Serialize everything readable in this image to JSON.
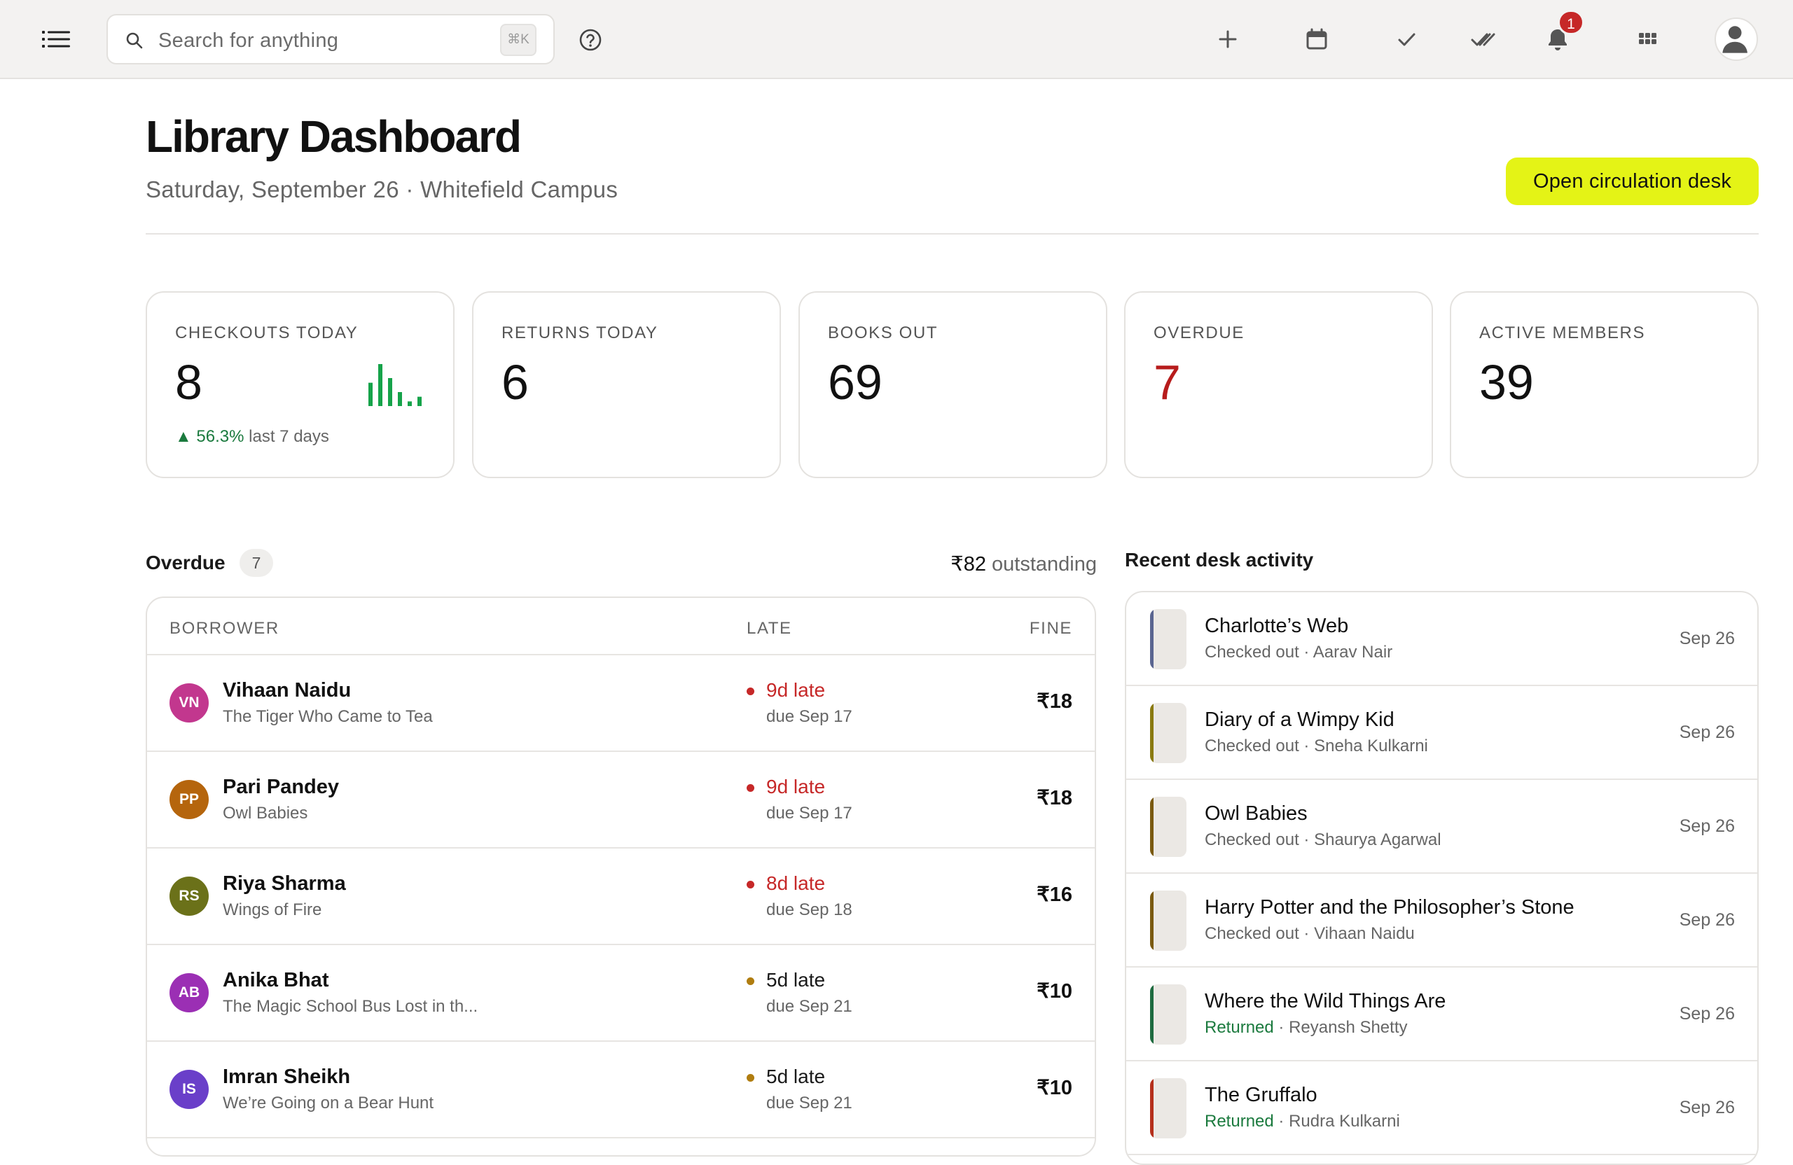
{
  "topbar": {
    "search_placeholder": "Search for anything",
    "search_shortcut": "⌘K",
    "notification_count": "1",
    "icons": [
      "menu-icon",
      "search-icon",
      "help-icon",
      "plus-icon",
      "calendar-icon",
      "check-icon",
      "double-check-icon",
      "bell-icon",
      "apps-grid-icon",
      "user-avatar"
    ]
  },
  "header": {
    "title": "Library Dashboard",
    "subtitle": "Saturday, September 26 · Whitefield Campus",
    "cta_label": "Open circulation desk",
    "cta_color": "#e4f316"
  },
  "stats": [
    {
      "label": "CHECKOUTS TODAY",
      "value": "8",
      "trend_value": "56.3%",
      "trend_text": "last 7 days",
      "spark": [
        5,
        9,
        6,
        3,
        1,
        2
      ]
    },
    {
      "label": "RETURNS TODAY",
      "value": "6"
    },
    {
      "label": "BOOKS OUT",
      "value": "69"
    },
    {
      "label": "OVERDUE",
      "value": "7"
    },
    {
      "label": "ACTIVE MEMBERS",
      "value": "39"
    }
  ],
  "overdue": {
    "title": "Overdue",
    "count": "7",
    "outstanding_amount": "₹82",
    "outstanding_label": "outstanding",
    "columns": [
      "BORROWER",
      "LATE",
      "FINE"
    ],
    "rows": [
      {
        "initials": "VN",
        "name": "Vihaan Naidu",
        "book": "The Tiger Who Came to Tea",
        "late": "9d late",
        "due": "due Sep 17",
        "fine": "₹18",
        "avatar_color": "#c2378e",
        "severity": "#c62828"
      },
      {
        "initials": "PP",
        "name": "Pari Pandey",
        "book": "Owl Babies",
        "late": "9d late",
        "due": "due Sep 17",
        "fine": "₹18",
        "avatar_color": "#b5650d",
        "severity": "#c62828"
      },
      {
        "initials": "RS",
        "name": "Riya Sharma",
        "book": "Wings of Fire",
        "late": "8d late",
        "due": "due Sep 18",
        "fine": "₹16",
        "avatar_color": "#6b7119",
        "severity": "#c62828"
      },
      {
        "initials": "AB",
        "name": "Anika Bhat",
        "book": "The Magic School Bus Lost in th...",
        "late": "5d late",
        "due": "due Sep 21",
        "fine": "₹10",
        "avatar_color": "#9b2fb4",
        "severity": "#b07d10"
      },
      {
        "initials": "IS",
        "name": "Imran Sheikh",
        "book": "We’re Going on a Bear Hunt",
        "late": "5d late",
        "due": "due Sep 21",
        "fine": "₹10",
        "avatar_color": "#6a3fc9",
        "severity": "#b07d10"
      }
    ]
  },
  "activity": {
    "title": "Recent desk activity",
    "items": [
      {
        "title": "Charlotte’s Web",
        "action": "Checked out",
        "person": "Aarav Nair",
        "date": "Sep 26",
        "spine_color": "#5a6590",
        "returned": false
      },
      {
        "title": "Diary of a Wimpy Kid",
        "action": "Checked out",
        "person": "Sneha Kulkarni",
        "date": "Sep 26",
        "spine_color": "#8a7a10",
        "returned": false
      },
      {
        "title": "Owl Babies",
        "action": "Checked out",
        "person": "Shaurya Agarwal",
        "date": "Sep 26",
        "spine_color": "#7a5a10",
        "returned": false
      },
      {
        "title": "Harry Potter and the Philosopher’s Stone",
        "action": "Checked out",
        "person": "Vihaan Naidu",
        "date": "Sep 26",
        "spine_color": "#7a5a10",
        "returned": false
      },
      {
        "title": "Where the Wild Things Are",
        "action": "Returned",
        "person": "Reyansh Shetty",
        "date": "Sep 26",
        "spine_color": "#1e6b40",
        "returned": true
      },
      {
        "title": "The Gruffalo",
        "action": "Returned",
        "person": "Rudra Kulkarni",
        "date": "Sep 26",
        "spine_color": "#b5301c",
        "returned": true
      }
    ]
  }
}
